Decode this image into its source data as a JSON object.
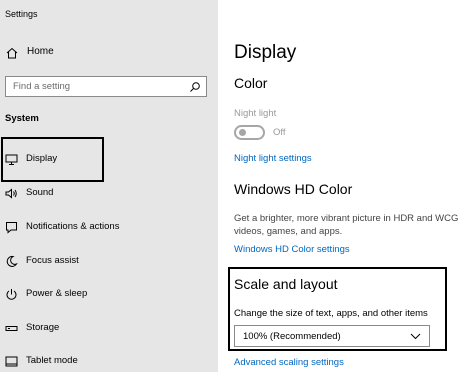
{
  "window": {
    "title": "Settings"
  },
  "sidebar": {
    "home_label": "Home",
    "search_placeholder": "Find a setting",
    "section_label": "System",
    "items": [
      {
        "label": "Display",
        "icon": "monitor-icon",
        "selected": true
      },
      {
        "label": "Sound",
        "icon": "speaker-icon"
      },
      {
        "label": "Notifications & actions",
        "icon": "notification-icon"
      },
      {
        "label": "Focus assist",
        "icon": "moon-icon"
      },
      {
        "label": "Power & sleep",
        "icon": "power-icon"
      },
      {
        "label": "Storage",
        "icon": "storage-icon"
      },
      {
        "label": "Tablet mode",
        "icon": "tablet-icon"
      }
    ]
  },
  "main": {
    "page_title": "Display",
    "color_heading": "Color",
    "night_light_label": "Night light",
    "night_light_state": "Off",
    "night_light_settings_link": "Night light settings",
    "hd_color_heading": "Windows HD Color",
    "hd_color_desc": "Get a brighter, more vibrant picture in HDR and WCG videos, games, and apps.",
    "hd_color_link": "Windows HD Color settings",
    "scale_heading": "Scale and layout",
    "scale_label": "Change the size of text, apps, and other items",
    "scale_value": "100% (Recommended)",
    "advanced_scaling_link": "Advanced scaling settings"
  },
  "colors": {
    "sidebar_bg": "#e6e6e6",
    "link": "#0067c0",
    "muted": "#9a9a9a"
  }
}
